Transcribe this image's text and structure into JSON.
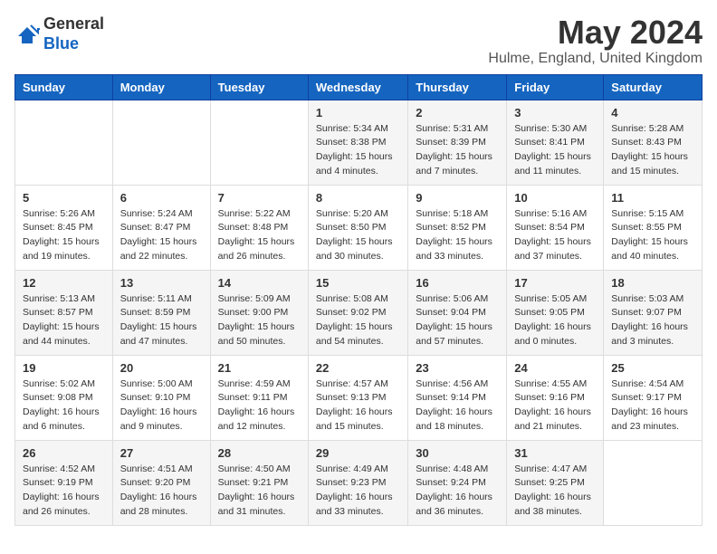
{
  "logo": {
    "general": "General",
    "blue": "Blue"
  },
  "title": {
    "month_year": "May 2024",
    "location": "Hulme, England, United Kingdom"
  },
  "headers": [
    "Sunday",
    "Monday",
    "Tuesday",
    "Wednesday",
    "Thursday",
    "Friday",
    "Saturday"
  ],
  "weeks": [
    [
      {
        "day": "",
        "info": ""
      },
      {
        "day": "",
        "info": ""
      },
      {
        "day": "",
        "info": ""
      },
      {
        "day": "1",
        "info": "Sunrise: 5:34 AM\nSunset: 8:38 PM\nDaylight: 15 hours\nand 4 minutes."
      },
      {
        "day": "2",
        "info": "Sunrise: 5:31 AM\nSunset: 8:39 PM\nDaylight: 15 hours\nand 7 minutes."
      },
      {
        "day": "3",
        "info": "Sunrise: 5:30 AM\nSunset: 8:41 PM\nDaylight: 15 hours\nand 11 minutes."
      },
      {
        "day": "4",
        "info": "Sunrise: 5:28 AM\nSunset: 8:43 PM\nDaylight: 15 hours\nand 15 minutes."
      }
    ],
    [
      {
        "day": "5",
        "info": "Sunrise: 5:26 AM\nSunset: 8:45 PM\nDaylight: 15 hours\nand 19 minutes."
      },
      {
        "day": "6",
        "info": "Sunrise: 5:24 AM\nSunset: 8:47 PM\nDaylight: 15 hours\nand 22 minutes."
      },
      {
        "day": "7",
        "info": "Sunrise: 5:22 AM\nSunset: 8:48 PM\nDaylight: 15 hours\nand 26 minutes."
      },
      {
        "day": "8",
        "info": "Sunrise: 5:20 AM\nSunset: 8:50 PM\nDaylight: 15 hours\nand 30 minutes."
      },
      {
        "day": "9",
        "info": "Sunrise: 5:18 AM\nSunset: 8:52 PM\nDaylight: 15 hours\nand 33 minutes."
      },
      {
        "day": "10",
        "info": "Sunrise: 5:16 AM\nSunset: 8:54 PM\nDaylight: 15 hours\nand 37 minutes."
      },
      {
        "day": "11",
        "info": "Sunrise: 5:15 AM\nSunset: 8:55 PM\nDaylight: 15 hours\nand 40 minutes."
      }
    ],
    [
      {
        "day": "12",
        "info": "Sunrise: 5:13 AM\nSunset: 8:57 PM\nDaylight: 15 hours\nand 44 minutes."
      },
      {
        "day": "13",
        "info": "Sunrise: 5:11 AM\nSunset: 8:59 PM\nDaylight: 15 hours\nand 47 minutes."
      },
      {
        "day": "14",
        "info": "Sunrise: 5:09 AM\nSunset: 9:00 PM\nDaylight: 15 hours\nand 50 minutes."
      },
      {
        "day": "15",
        "info": "Sunrise: 5:08 AM\nSunset: 9:02 PM\nDaylight: 15 hours\nand 54 minutes."
      },
      {
        "day": "16",
        "info": "Sunrise: 5:06 AM\nSunset: 9:04 PM\nDaylight: 15 hours\nand 57 minutes."
      },
      {
        "day": "17",
        "info": "Sunrise: 5:05 AM\nSunset: 9:05 PM\nDaylight: 16 hours\nand 0 minutes."
      },
      {
        "day": "18",
        "info": "Sunrise: 5:03 AM\nSunset: 9:07 PM\nDaylight: 16 hours\nand 3 minutes."
      }
    ],
    [
      {
        "day": "19",
        "info": "Sunrise: 5:02 AM\nSunset: 9:08 PM\nDaylight: 16 hours\nand 6 minutes."
      },
      {
        "day": "20",
        "info": "Sunrise: 5:00 AM\nSunset: 9:10 PM\nDaylight: 16 hours\nand 9 minutes."
      },
      {
        "day": "21",
        "info": "Sunrise: 4:59 AM\nSunset: 9:11 PM\nDaylight: 16 hours\nand 12 minutes."
      },
      {
        "day": "22",
        "info": "Sunrise: 4:57 AM\nSunset: 9:13 PM\nDaylight: 16 hours\nand 15 minutes."
      },
      {
        "day": "23",
        "info": "Sunrise: 4:56 AM\nSunset: 9:14 PM\nDaylight: 16 hours\nand 18 minutes."
      },
      {
        "day": "24",
        "info": "Sunrise: 4:55 AM\nSunset: 9:16 PM\nDaylight: 16 hours\nand 21 minutes."
      },
      {
        "day": "25",
        "info": "Sunrise: 4:54 AM\nSunset: 9:17 PM\nDaylight: 16 hours\nand 23 minutes."
      }
    ],
    [
      {
        "day": "26",
        "info": "Sunrise: 4:52 AM\nSunset: 9:19 PM\nDaylight: 16 hours\nand 26 minutes."
      },
      {
        "day": "27",
        "info": "Sunrise: 4:51 AM\nSunset: 9:20 PM\nDaylight: 16 hours\nand 28 minutes."
      },
      {
        "day": "28",
        "info": "Sunrise: 4:50 AM\nSunset: 9:21 PM\nDaylight: 16 hours\nand 31 minutes."
      },
      {
        "day": "29",
        "info": "Sunrise: 4:49 AM\nSunset: 9:23 PM\nDaylight: 16 hours\nand 33 minutes."
      },
      {
        "day": "30",
        "info": "Sunrise: 4:48 AM\nSunset: 9:24 PM\nDaylight: 16 hours\nand 36 minutes."
      },
      {
        "day": "31",
        "info": "Sunrise: 4:47 AM\nSunset: 9:25 PM\nDaylight: 16 hours\nand 38 minutes."
      },
      {
        "day": "",
        "info": ""
      }
    ]
  ]
}
